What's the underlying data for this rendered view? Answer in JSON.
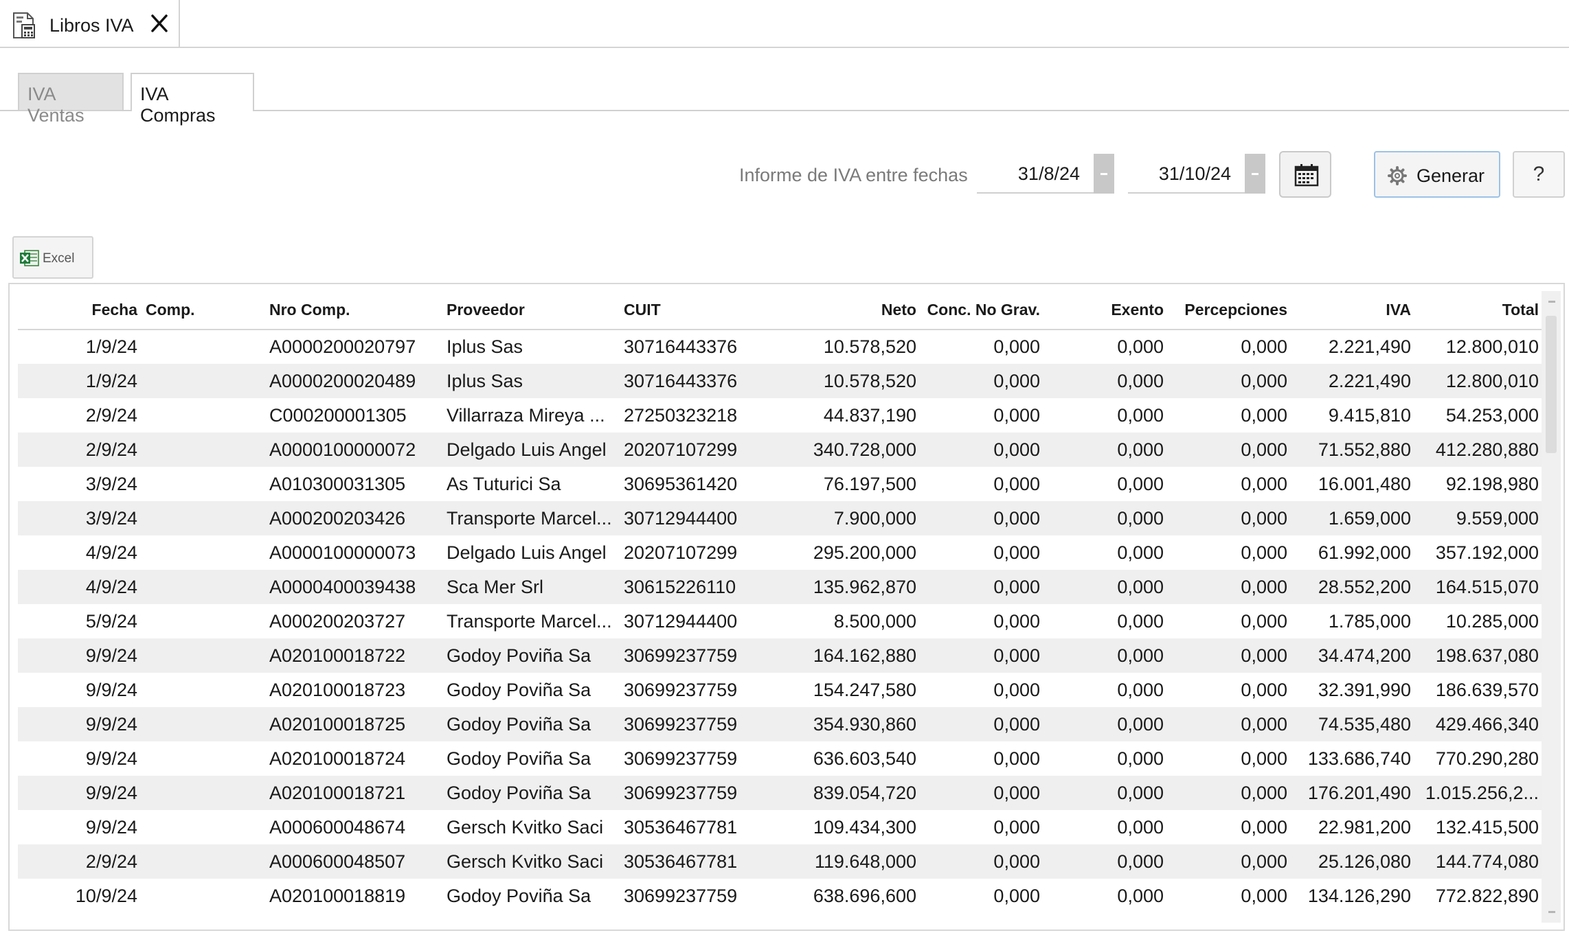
{
  "window": {
    "tab_title": "Libros IVA"
  },
  "tabs": [
    {
      "label": "IVA Ventas",
      "active": false
    },
    {
      "label": "IVA Compras",
      "active": true
    }
  ],
  "toolbar": {
    "date_range_label": "Informe de IVA entre fechas",
    "date_from": "31/8/24",
    "date_to": "31/10/24",
    "generate_label": "Generar",
    "help_label": "?",
    "export_label": "Excel"
  },
  "table": {
    "columns": [
      "Fecha",
      "Comp.",
      "Nro Comp.",
      "Proveedor",
      "CUIT",
      "Neto",
      "Conc. No Grav.",
      "Exento",
      "Percepciones",
      "IVA",
      "Total"
    ],
    "rows": [
      [
        "1/9/24",
        "",
        "A0000200020797",
        "Iplus Sas",
        "30716443376",
        "10.578,520",
        "0,000",
        "0,000",
        "0,000",
        "2.221,490",
        "12.800,010"
      ],
      [
        "1/9/24",
        "",
        "A0000200020489",
        "Iplus Sas",
        "30716443376",
        "10.578,520",
        "0,000",
        "0,000",
        "0,000",
        "2.221,490",
        "12.800,010"
      ],
      [
        "2/9/24",
        "",
        "C000200001305",
        "Villarraza Mireya ...",
        "27250323218",
        "44.837,190",
        "0,000",
        "0,000",
        "0,000",
        "9.415,810",
        "54.253,000"
      ],
      [
        "2/9/24",
        "",
        "A0000100000072",
        "Delgado Luis Angel",
        "20207107299",
        "340.728,000",
        "0,000",
        "0,000",
        "0,000",
        "71.552,880",
        "412.280,880"
      ],
      [
        "3/9/24",
        "",
        "A010300031305",
        "As Tuturici Sa",
        "30695361420",
        "76.197,500",
        "0,000",
        "0,000",
        "0,000",
        "16.001,480",
        "92.198,980"
      ],
      [
        "3/9/24",
        "",
        "A000200203426",
        "Transporte Marcel...",
        "30712944400",
        "7.900,000",
        "0,000",
        "0,000",
        "0,000",
        "1.659,000",
        "9.559,000"
      ],
      [
        "4/9/24",
        "",
        "A0000100000073",
        "Delgado Luis Angel",
        "20207107299",
        "295.200,000",
        "0,000",
        "0,000",
        "0,000",
        "61.992,000",
        "357.192,000"
      ],
      [
        "4/9/24",
        "",
        "A0000400039438",
        "Sca Mer Srl",
        "30615226110",
        "135.962,870",
        "0,000",
        "0,000",
        "0,000",
        "28.552,200",
        "164.515,070"
      ],
      [
        "5/9/24",
        "",
        "A000200203727",
        "Transporte Marcel...",
        "30712944400",
        "8.500,000",
        "0,000",
        "0,000",
        "0,000",
        "1.785,000",
        "10.285,000"
      ],
      [
        "9/9/24",
        "",
        "A020100018722",
        "Godoy Poviña Sa",
        "30699237759",
        "164.162,880",
        "0,000",
        "0,000",
        "0,000",
        "34.474,200",
        "198.637,080"
      ],
      [
        "9/9/24",
        "",
        "A020100018723",
        "Godoy Poviña Sa",
        "30699237759",
        "154.247,580",
        "0,000",
        "0,000",
        "0,000",
        "32.391,990",
        "186.639,570"
      ],
      [
        "9/9/24",
        "",
        "A020100018725",
        "Godoy Poviña Sa",
        "30699237759",
        "354.930,860",
        "0,000",
        "0,000",
        "0,000",
        "74.535,480",
        "429.466,340"
      ],
      [
        "9/9/24",
        "",
        "A020100018724",
        "Godoy Poviña Sa",
        "30699237759",
        "636.603,540",
        "0,000",
        "0,000",
        "0,000",
        "133.686,740",
        "770.290,280"
      ],
      [
        "9/9/24",
        "",
        "A020100018721",
        "Godoy Poviña Sa",
        "30699237759",
        "839.054,720",
        "0,000",
        "0,000",
        "0,000",
        "176.201,490",
        "1.015.256,2..."
      ],
      [
        "9/9/24",
        "",
        "A000600048674",
        "Gersch Kvitko Saci",
        "30536467781",
        "109.434,300",
        "0,000",
        "0,000",
        "0,000",
        "22.981,200",
        "132.415,500"
      ],
      [
        "2/9/24",
        "",
        "A000600048507",
        "Gersch Kvitko Saci",
        "30536467781",
        "119.648,000",
        "0,000",
        "0,000",
        "0,000",
        "25.126,080",
        "144.774,080"
      ],
      [
        "10/9/24",
        "",
        "A020100018819",
        "Godoy Poviña Sa",
        "30699237759",
        "638.696,600",
        "0,000",
        "0,000",
        "0,000",
        "134.126,290",
        "772.822,890"
      ]
    ]
  }
}
